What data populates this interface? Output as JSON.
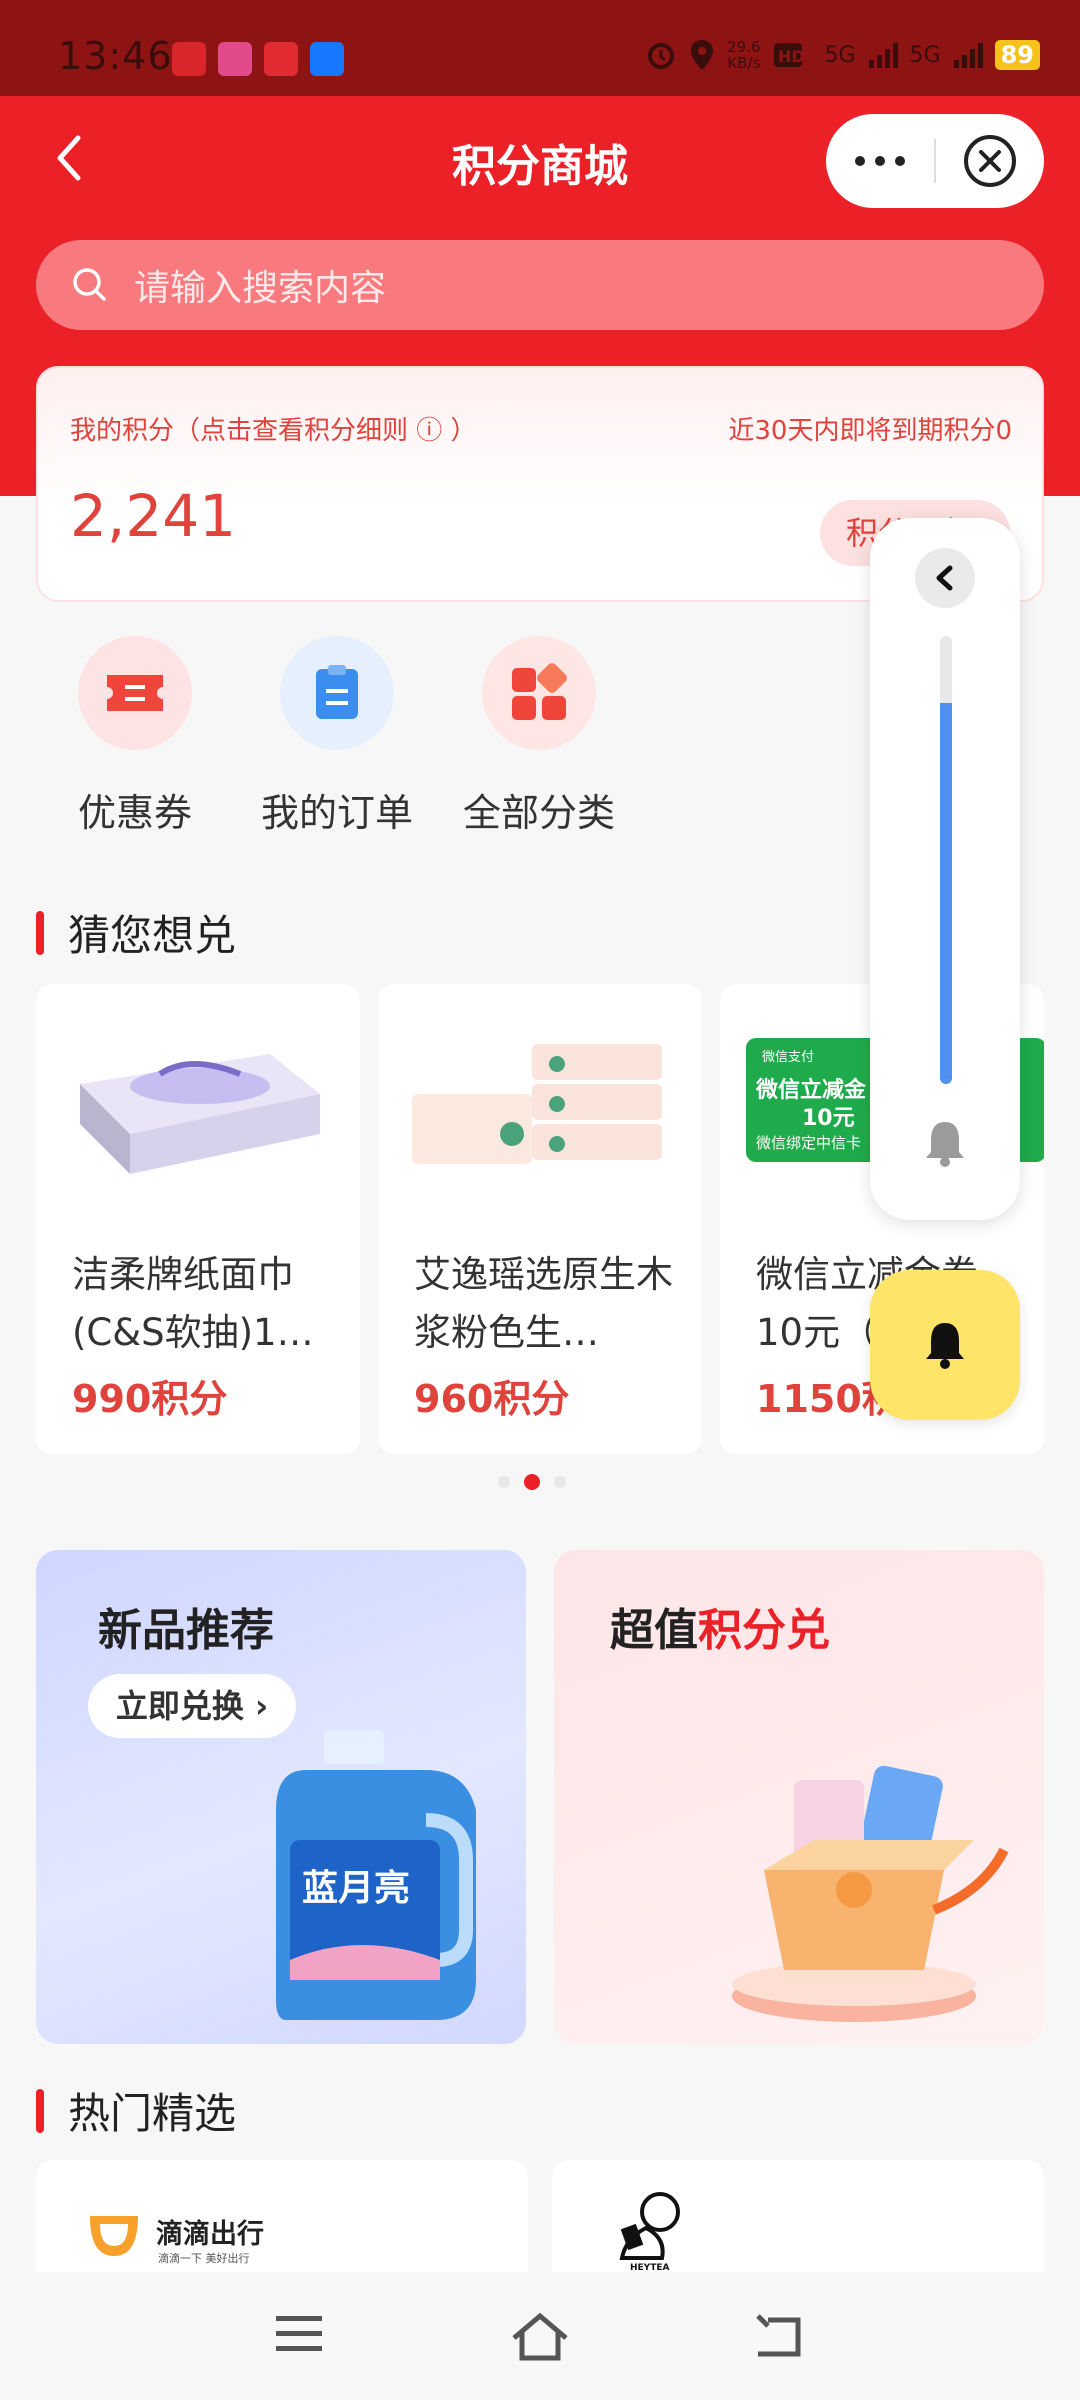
{
  "status_bar": {
    "time": "13:46",
    "network_speed_value": "29.6",
    "network_speed_unit": "KB/s",
    "signal_1": "5G",
    "signal_2": "5G",
    "battery": "89",
    "icons": [
      "alarm-icon",
      "location-icon",
      "hd-icon",
      "signal-icon",
      "battery-icon"
    ]
  },
  "header": {
    "title": "积分商城",
    "back_icon": "chevron-left-icon",
    "more_icon": "more-dots-icon",
    "close_icon": "close-circle-icon"
  },
  "search": {
    "placeholder": "请输入搜索内容"
  },
  "points_card": {
    "label": "我的积分（点击查看积分细则 ⓘ ）",
    "expiring": "近30天内即将到期积分0",
    "value": "2,241",
    "button_label": "积分明细"
  },
  "shortcuts": [
    {
      "label": "优惠券",
      "icon": "coupon-icon"
    },
    {
      "label": "我的订单",
      "icon": "clipboard-icon"
    },
    {
      "label": "全部分类",
      "icon": "grid-icon"
    }
  ],
  "sections": {
    "recommend_title": "猜您想兑",
    "hot_title": "热门精选"
  },
  "products": [
    {
      "name": "洁柔牌纸面巾(C&S软抽)1…",
      "price": "990积分"
    },
    {
      "name": "艾逸瑶选原生木浆粉色生…",
      "price": "960积分"
    },
    {
      "name": "微信立减金券10元（…",
      "price": "1150积分"
    }
  ],
  "wechat_coupon_image": {
    "brand": "微信支付",
    "line1": "微信立减金",
    "line2": "10元",
    "line3": "微信绑定中信卡"
  },
  "carousel": {
    "pages": 3,
    "active": 2
  },
  "banners": {
    "new": {
      "title": "新品推荐",
      "button": "立即兑换 ›",
      "product_brand": "蓝月亮"
    },
    "value": {
      "title_prefix": "超值",
      "title_highlight": "积分兑"
    }
  },
  "hot_picks": [
    {
      "brand": "滴滴出行",
      "tagline": "滴滴一下 美好出行"
    },
    {
      "brand": "HEYTEA"
    }
  ],
  "side_panel": {
    "back_icon": "chevron-left-icon",
    "slider_level": 0.85,
    "bell_icon": "bell-icon"
  },
  "colors": {
    "brand_red": "#ec2027",
    "price_red": "#e0433c",
    "status_bar": "#8e1414",
    "slider_blue": "#4f8ff0",
    "bell_yellow": "#ffe46a"
  }
}
